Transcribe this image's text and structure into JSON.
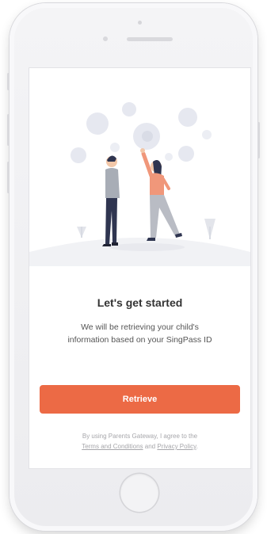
{
  "onboarding": {
    "title": "Let's get started",
    "body_line1": "We will be retrieving your child's",
    "body_line2": "information based on your SingPass ID",
    "retrieve_label": "Retrieve",
    "terms_prefix": "By using Parents Gateway, I agree to the",
    "terms_link": "Terms and Conditions",
    "terms_and": " and ",
    "privacy_link": "Privacy Policy",
    "terms_suffix": "."
  },
  "colors": {
    "accent": "#ec6a45",
    "bubble": "#e6e8f0",
    "woman_top": "#f0977a",
    "pants": "#2f3550",
    "man_top": "#a8adb6"
  },
  "icons": {
    "illustration": "people-reaching-bubbles-illustration",
    "home_button": "home-button"
  }
}
